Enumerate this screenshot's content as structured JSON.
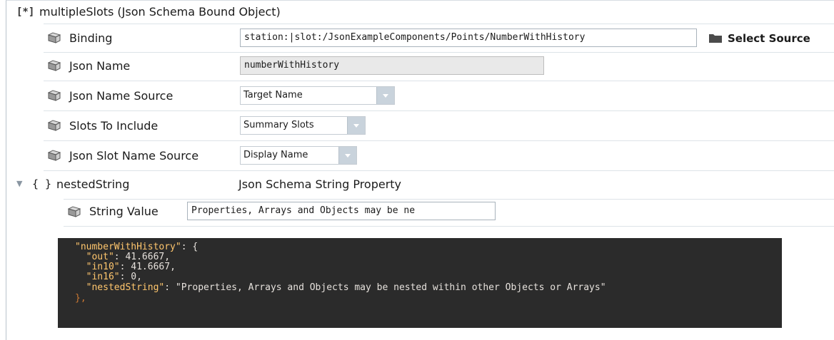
{
  "header": {
    "icon": "[*]",
    "title": "multipleSlots  (Json Schema Bound Object)"
  },
  "props": [
    {
      "name": "Binding",
      "value": "station:|slot:/JsonExampleComponents/Points/NumberWithHistory",
      "action": "Select Source"
    },
    {
      "name": "Json Name",
      "value": "numberWithHistory"
    },
    {
      "name": "Json Name Source",
      "selected": "Target Name"
    },
    {
      "name": "Slots To Include",
      "selected": "Summary Slots"
    },
    {
      "name": "Json Slot Name Source",
      "selected": "Display Name"
    }
  ],
  "nested": {
    "toggle": "▼",
    "icon": "{ }",
    "name": "nestedString",
    "type": "Json Schema String Property",
    "child": {
      "name": "String Value",
      "value": "Properties, Arrays and Objects may be ne"
    }
  },
  "code": {
    "lines": [
      {
        "key": "\"numberWithHistory\"",
        "rest": ": {"
      },
      {
        "key": "  \"out\"",
        "rest": ": 41.6667,"
      },
      {
        "key": "  \"in10\"",
        "rest": ": 41.6667,"
      },
      {
        "key": "  \"in16\"",
        "rest": ": 0,"
      },
      {
        "key": "  \"nestedString\"",
        "rest": ": \"Properties, Arrays and Objects may be nested within other Objects or Arrays\""
      },
      {
        "key": "",
        "rest": "},"
      }
    ]
  },
  "icons": {
    "slot": "slot-icon",
    "folder": "folder-icon"
  }
}
